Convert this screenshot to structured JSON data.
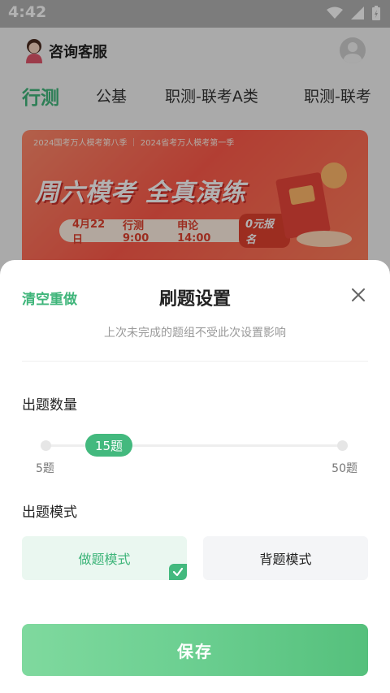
{
  "status_bar": {
    "time": "4:42"
  },
  "header": {
    "customer_service": "咨询客服"
  },
  "tabs": [
    {
      "label": "行测",
      "active": true
    },
    {
      "label": "公基",
      "active": false
    },
    {
      "label": "职测-联考A类",
      "active": false
    },
    {
      "label": "职测-联考",
      "active": false
    }
  ],
  "banner": {
    "top_text": "2024国考万人模考第八季 ｜ 2024省考万人模考第一季",
    "title": "周六模考 全真演练",
    "date": "4月22日",
    "xingce_time": "行测9:00",
    "shenlun_time": "申论14:00",
    "signup_badge": "0元报名"
  },
  "sheet": {
    "clear_label": "清空重做",
    "title": "刷题设置",
    "hint": "上次未完成的题组不受此次设置影响",
    "count_label": "出题数量",
    "slider": {
      "value_label": "15题",
      "min_label": "5题",
      "max_label": "50题",
      "min": 5,
      "max": 50,
      "value": 15
    },
    "mode_label": "出题模式",
    "modes": [
      {
        "label": "做题模式",
        "selected": true
      },
      {
        "label": "背题模式",
        "selected": false
      }
    ],
    "save_label": "保存"
  },
  "colors": {
    "accent": "#43b97e",
    "accent_text": "#3fb57a",
    "banner_red": "#ff5a4a"
  }
}
